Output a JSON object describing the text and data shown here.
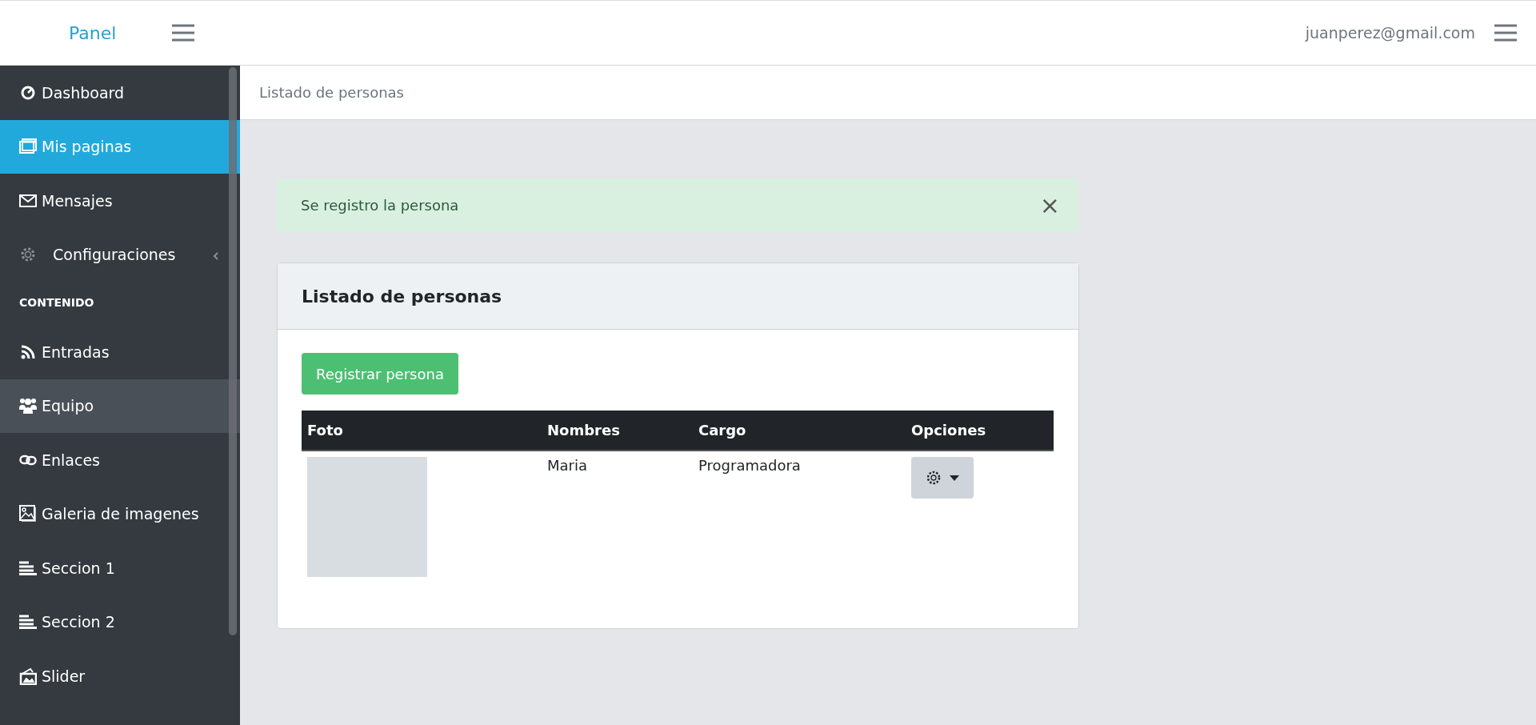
{
  "navbar": {
    "brand": "Panel",
    "user_email": "juanperez@gmail.com"
  },
  "sidebar": {
    "items": [
      {
        "kind": "link",
        "label": "Dashboard",
        "selected": false,
        "hovered": false
      },
      {
        "kind": "link",
        "label": "Mis paginas",
        "selected": true,
        "hovered": false
      },
      {
        "kind": "link",
        "label": "Mensajes",
        "selected": false,
        "hovered": false
      },
      {
        "kind": "submenu",
        "label": "Configuraciones",
        "selected": false,
        "hovered": false,
        "expanded": false
      },
      {
        "kind": "header",
        "label": "CONTENIDO"
      },
      {
        "kind": "link",
        "label": "Entradas",
        "selected": false,
        "hovered": false
      },
      {
        "kind": "link",
        "label": "Equipo",
        "selected": false,
        "hovered": true
      },
      {
        "kind": "link",
        "label": "Enlaces",
        "selected": false,
        "hovered": false
      },
      {
        "kind": "link",
        "label": "Galeria de imagenes",
        "selected": false,
        "hovered": false
      },
      {
        "kind": "link",
        "label": "Seccion 1",
        "selected": false,
        "hovered": false
      },
      {
        "kind": "link",
        "label": "Seccion 2",
        "selected": false,
        "hovered": false
      },
      {
        "kind": "link",
        "label": "Slider",
        "selected": false,
        "hovered": false
      }
    ]
  },
  "breadcrumb": "Listado de personas",
  "alert": {
    "message": "Se registro la persona",
    "close": "×"
  },
  "card": {
    "title": "Listado de personas",
    "button": "Registrar persona",
    "table": {
      "columns": [
        "Foto",
        "Nombres",
        "Cargo",
        "Opciones"
      ],
      "rows": [
        {
          "nombres": "Maria",
          "cargo": "Programadora"
        }
      ]
    }
  }
}
